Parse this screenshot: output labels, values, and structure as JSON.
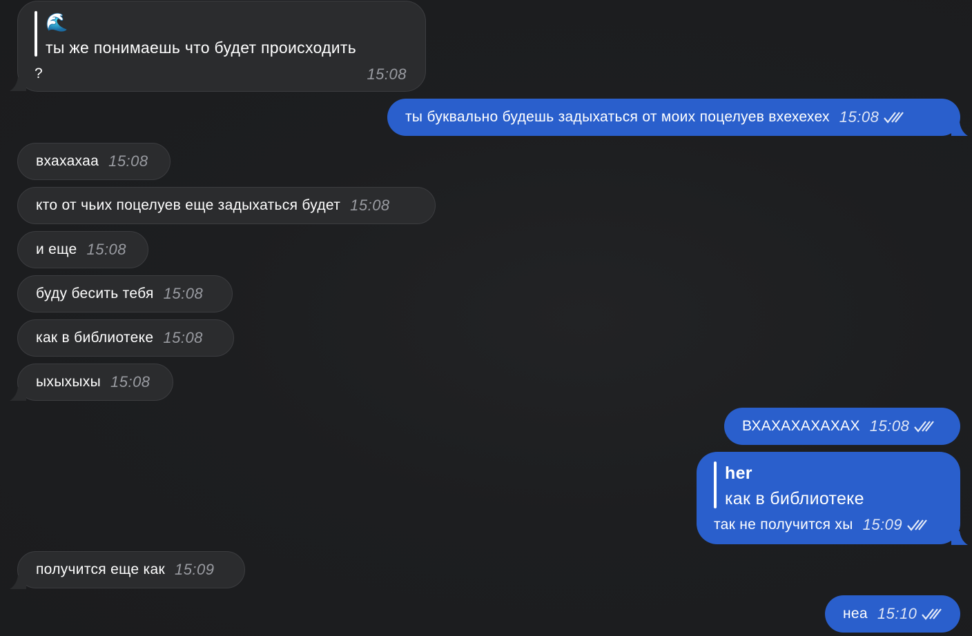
{
  "messages": {
    "m1": {
      "reply_emoji": "🌊",
      "reply_text": "ты же понимаешь что будет происходить",
      "text": "?",
      "time": "15:08"
    },
    "m2": {
      "text": "ты буквально будешь задыхаться от моих поцелуев вхехехех",
      "time": "15:08"
    },
    "m3": {
      "text": "вхахахаа",
      "time": "15:08"
    },
    "m4": {
      "text": "кто от чьих поцелуев еще задыхаться будет",
      "time": "15:08"
    },
    "m5": {
      "text": "и еще",
      "time": "15:08"
    },
    "m6": {
      "text": "буду бесить тебя",
      "time": "15:08"
    },
    "m7": {
      "text": "как в библиотеке",
      "time": "15:08"
    },
    "m8": {
      "text": "ыхыхыхы",
      "time": "15:08"
    },
    "m9": {
      "text": "ВХАХАХАХАХАХ",
      "time": "15:08"
    },
    "m10": {
      "reply_author": "her",
      "reply_text": "как в библиотеке",
      "text": "так не получится хы",
      "time": "15:09"
    },
    "m11": {
      "text": "получится еще как",
      "time": "15:09"
    },
    "m12": {
      "text": "неа",
      "time": "15:10"
    }
  },
  "colors": {
    "background": "#1c1d1f",
    "incoming_bubble": "#2b2c2e",
    "outgoing_bubble": "#2a5fcc"
  },
  "icons": {
    "read_status": "double-check-icon",
    "reply_emoji": "wave-emoji"
  }
}
